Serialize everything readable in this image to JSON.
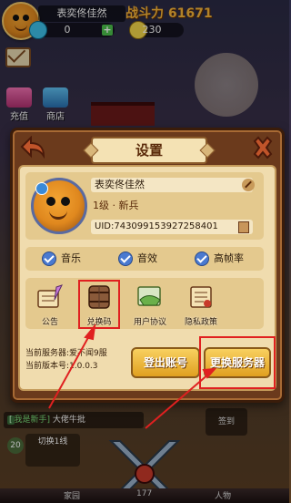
{
  "hud": {
    "player_name": "表奕佟佳然",
    "power_label": "战斗力 61671",
    "resource1": "0",
    "resource2": "230",
    "recharge_label": "充值",
    "shop_label": "商店"
  },
  "settings": {
    "title": "设置",
    "profile": {
      "name": "表奕佟佳然",
      "rank": "1级 · 新兵",
      "uid": "UID:7430991539272584​01"
    },
    "toggles": [
      {
        "label": "音乐",
        "checked": true
      },
      {
        "label": "音效",
        "checked": true
      },
      {
        "label": "高帧率",
        "checked": true
      }
    ],
    "actions": [
      {
        "label": "公告",
        "icon": "scroll-feather-icon"
      },
      {
        "label": "兑换码",
        "icon": "barrel-icon"
      },
      {
        "label": "用户协议",
        "icon": "handshake-icon"
      },
      {
        "label": "隐私政策",
        "icon": "document-scroll-icon"
      }
    ],
    "server_line": "当前服务器:爱不闻9服",
    "version_line": "当前版本号:1.0.0.3",
    "logout_label": "登出账号",
    "switch_server_label": "更换服务器"
  },
  "background": {
    "chat_channel": "[",
    "chat_tag": "我是新手]",
    "chat_text": "大佬牛批",
    "switch_line_label": "切换1线",
    "level": "20",
    "right_button": "签到",
    "dock": [
      "家园",
      "177",
      "人物"
    ]
  },
  "colors": {
    "panel_border": "#6b3a1c",
    "panel_fill": "#f0dcae",
    "button_gold": "#f0b830",
    "highlight_red": "#e02020"
  }
}
